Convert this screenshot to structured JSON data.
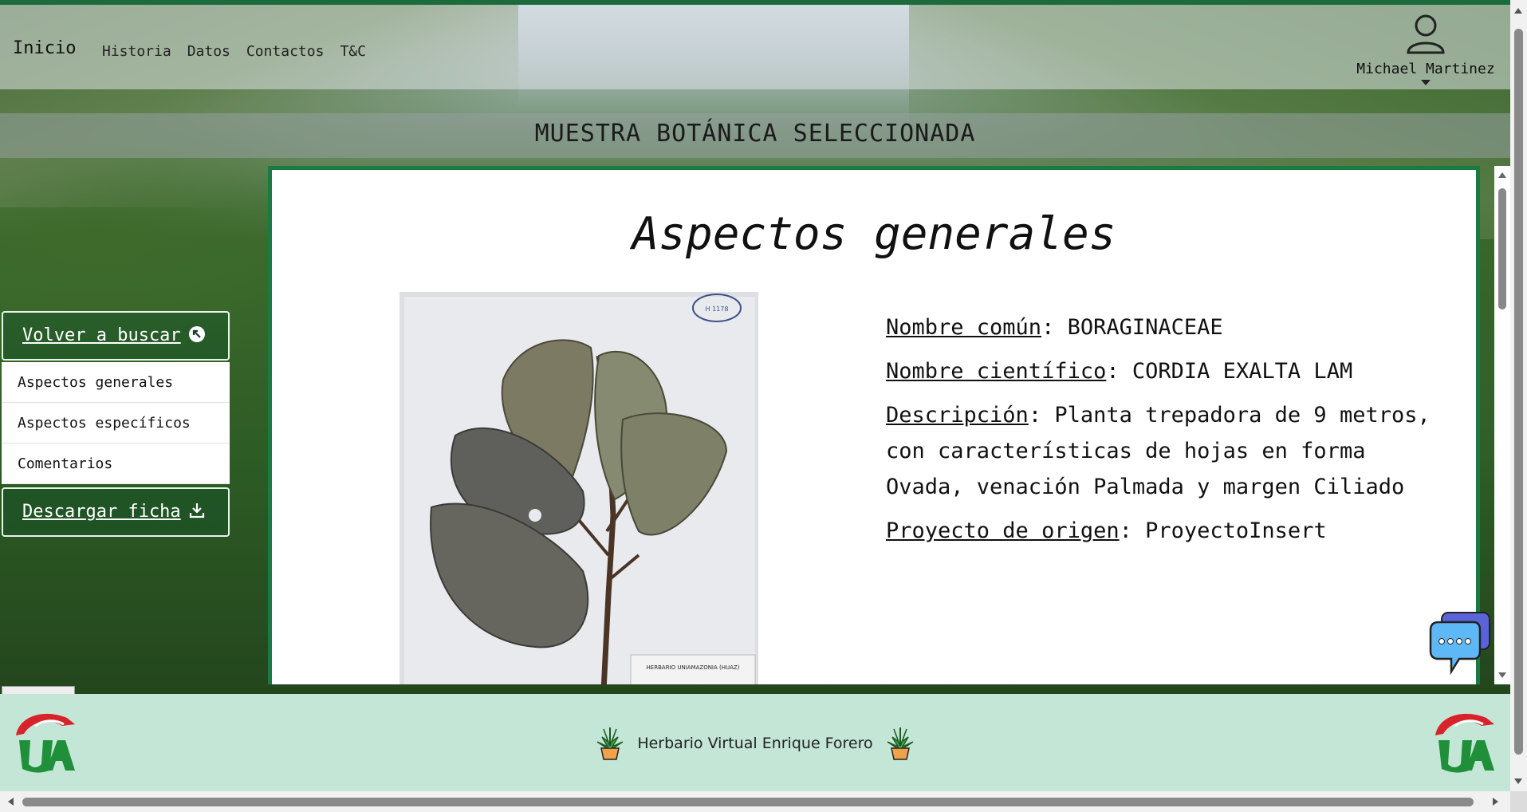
{
  "nav": {
    "brand": "Inicio",
    "links": [
      "Historia",
      "Datos",
      "Contactos",
      "T&C"
    ],
    "user_name": "Michael Martinez"
  },
  "page_title": "MUESTRA BOTÁNICA SELECCIONADA",
  "sidebar": {
    "back_button": "Volver a buscar",
    "menu": [
      "Aspectos generales",
      "Aspectos específicos",
      "Comentarios"
    ],
    "download_button": "Descargar ficha"
  },
  "content": {
    "heading": "Aspectos generales",
    "fields": [
      {
        "label": "Nombre común",
        "value": "BORAGINACEAE"
      },
      {
        "label": "Nombre científico",
        "value": "CORDIA EXALTA LAM"
      },
      {
        "label": "Descripción",
        "value": "Planta trepadora de 9 metros, con características de hojas en forma Ovada, venación Palmada y margen Ciliado"
      },
      {
        "label": "Proyecto de origen",
        "value": "ProyectoInsert"
      }
    ],
    "specimen_label": "HERBARIO UNIAMAZONIA (HUAZ)",
    "specimen_stamp": "H 1178"
  },
  "footer": {
    "text": "Herbario Virtual Enrique Forero"
  },
  "colors": {
    "accent": "#1b7a44",
    "footer_bg": "#c3e6d6",
    "logo_red": "#d8232a",
    "logo_green": "#1f8f3a"
  }
}
